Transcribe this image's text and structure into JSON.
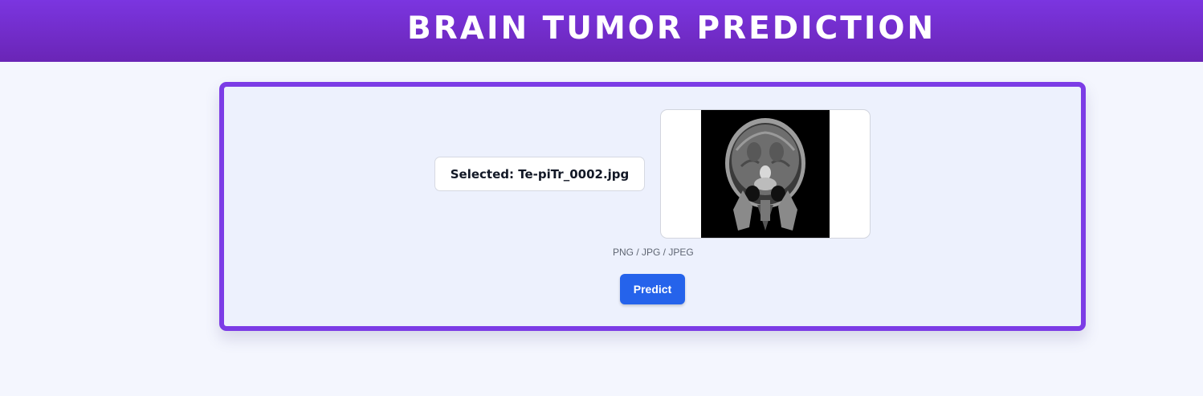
{
  "header": {
    "title": "BRAIN TUMOR PREDICTION",
    "background_color": "#7b35e0"
  },
  "upload": {
    "selected_file_label": "Selected: Te-piTr_0002.jpg",
    "formats_hint": "PNG / JPG / JPEG",
    "preview_image": "brain-mri-coronal-scan"
  },
  "actions": {
    "predict_label": "Predict",
    "predict_color": "#2563eb"
  },
  "theme": {
    "card_border_color": "#7c3ce6",
    "page_background": "#f4f6fe"
  }
}
